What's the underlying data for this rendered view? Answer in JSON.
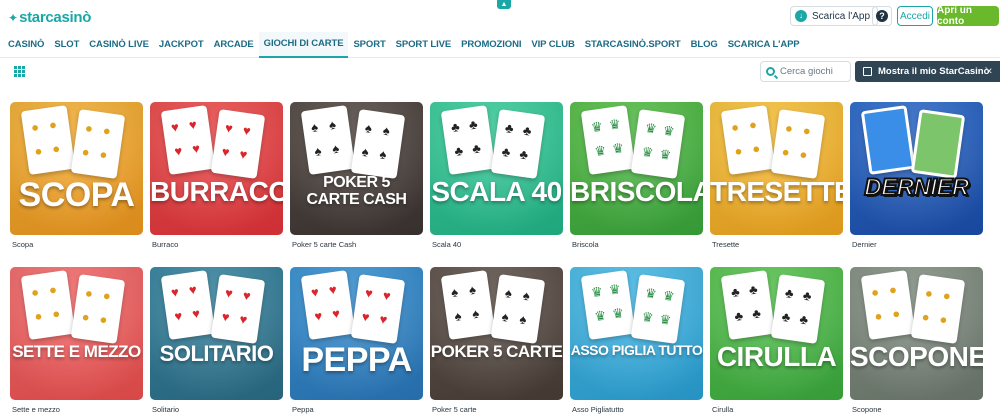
{
  "header": {
    "logo_text": "starcasinò",
    "download_app": "Scarica l'App",
    "help_glyph": "?",
    "login": "Accedi",
    "open_account": "Apri un conto"
  },
  "nav": [
    "CASINÒ",
    "SLOT",
    "CASINÒ LIVE",
    "JACKPOT",
    "ARCADE",
    "GIOCHI DI CARTE",
    "SPORT",
    "SPORT LIVE",
    "PROMOZIONI",
    "VIP CLUB",
    "STARCASINÒ.SPORT",
    "BLOG",
    "SCARICA L'APP"
  ],
  "nav_active": "GIOCHI DI CARTE",
  "toolbar": {
    "search_placeholder": "Cerca giochi",
    "my_starcasino": "Mostra il mio StarCasinò"
  },
  "games": [
    {
      "title": "SCOPA",
      "caption": "Scopa",
      "bg": "#f39a1e",
      "bg2": "#f7b53a",
      "suit": "coins"
    },
    {
      "title": "BURRACO",
      "caption": "Burraco",
      "bg": "#e5343a",
      "bg2": "#f0504f",
      "suit": "hearts"
    },
    {
      "title": "POKER 5 CARTE CASH",
      "caption": "Poker 5 carte Cash",
      "bg": "#3d3532",
      "bg2": "#5a4f49",
      "suit": "spades"
    },
    {
      "title": "SCALA 40",
      "caption": "Scala 40",
      "bg": "#22b98a",
      "bg2": "#3fd3a0",
      "suit": "clubs"
    },
    {
      "title": "BRISCOLA",
      "caption": "Briscola",
      "bg": "#3aa93b",
      "bg2": "#5cc44c",
      "suit": "cups"
    },
    {
      "title": "TRESETTE",
      "caption": "Tresette",
      "bg": "#f5a81f",
      "bg2": "#fbc840",
      "suit": "coins"
    },
    {
      "title": "DERNIER",
      "caption": "Dernier",
      "bg": "#1b4fae",
      "bg2": "#2f6fd0",
      "suit": "uno"
    },
    {
      "title": "SETTE E MEZZO",
      "caption": "Sette e mezzo",
      "bg": "#ef4f4f",
      "bg2": "#f77070",
      "suit": "coins"
    },
    {
      "title": "SOLITARIO",
      "caption": "Solitario",
      "bg": "#2b6f89",
      "bg2": "#3b8aa6",
      "suit": "hearts"
    },
    {
      "title": "PEPPA",
      "caption": "Peppa",
      "bg": "#2a79bd",
      "bg2": "#3c97d8",
      "suit": "hearts"
    },
    {
      "title": "POKER 5 CARTE",
      "caption": "Poker 5 carte",
      "bg": "#4a3f38",
      "bg2": "#655850",
      "suit": "spades"
    },
    {
      "title": "ASSO PIGLIA TUTTO",
      "caption": "Asso Pigliatutto",
      "bg": "#29a3d9",
      "bg2": "#4fc1ec",
      "suit": "cups"
    },
    {
      "title": "CIRULLA",
      "caption": "Cirulla",
      "bg": "#3cae3e",
      "bg2": "#5fca55",
      "suit": "clubs"
    },
    {
      "title": "SCOPONE",
      "caption": "Scopone",
      "bg": "#6f7b70",
      "bg2": "#8b978a",
      "suit": "coins"
    }
  ]
}
